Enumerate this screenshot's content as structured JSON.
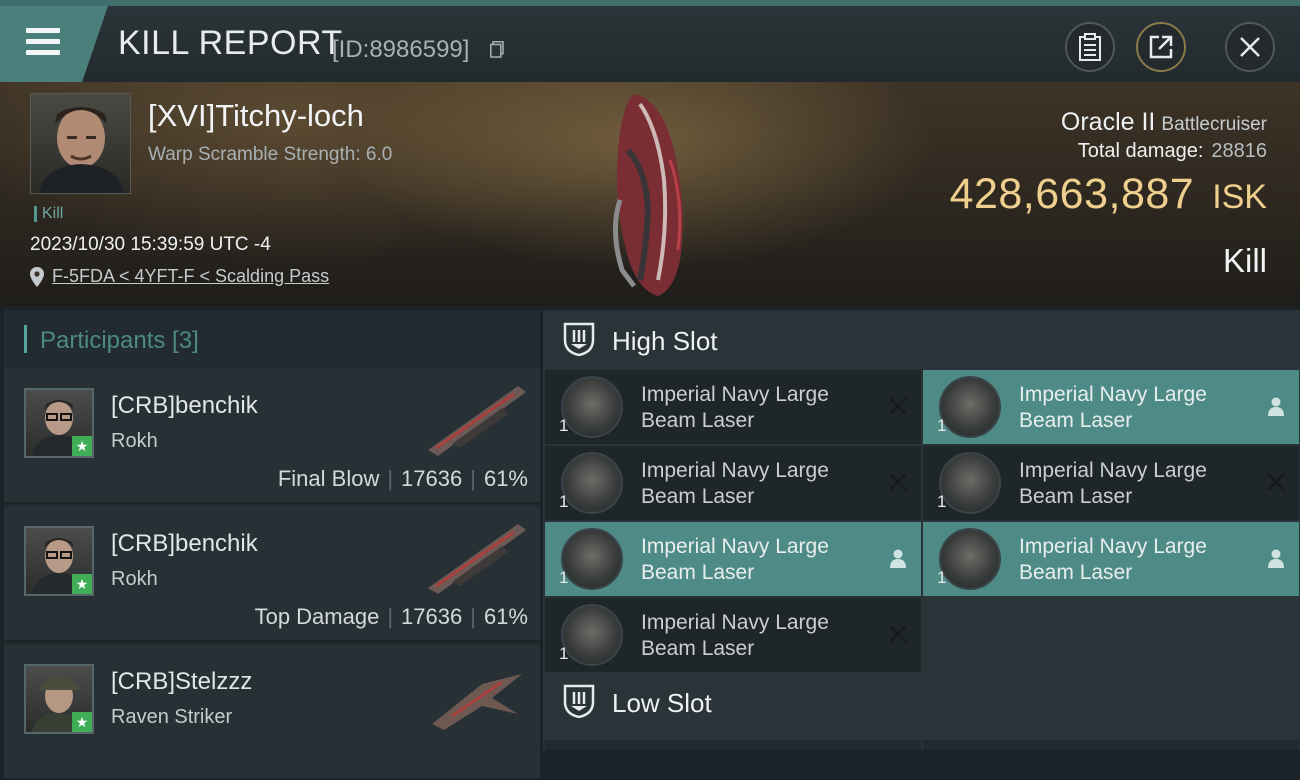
{
  "header": {
    "title": "KILL REPORT",
    "report_id": "[ID:8986599]"
  },
  "victim": {
    "name": "[XVI]Titchy-loch",
    "warp_scramble": "Warp Scramble Strength: 6.0",
    "tag": "Kill",
    "datetime": "2023/10/30 15:39:59 UTC -4",
    "location": "F-5FDA < 4YFT-F < Scalding Pass",
    "ship_name": "Oracle II",
    "ship_class": "Battlecruiser",
    "total_damage_label": "Total damage:",
    "total_damage_value": "28816",
    "isk_value": "428,663,887",
    "isk_unit": "ISK",
    "result": "Kill"
  },
  "participants": {
    "title": "Participants [3]",
    "rows": [
      {
        "name": "[CRB]benchik",
        "ship": "Rokh",
        "role": "Final Blow",
        "damage": "17636",
        "percent": "61%"
      },
      {
        "name": "[CRB]benchik",
        "ship": "Rokh",
        "role": "Top Damage",
        "damage": "17636",
        "percent": "61%"
      },
      {
        "name": "[CRB]Stelzzz",
        "ship": "Raven Striker",
        "role": "",
        "damage": "",
        "percent": ""
      }
    ]
  },
  "slots": {
    "high_title": "High Slot",
    "low_title": "Low Slot",
    "modules": [
      {
        "name": "Imperial Navy Large Beam Laser",
        "qty": "1",
        "state": "destroyed",
        "style": "dark"
      },
      {
        "name": "Imperial Navy Large Beam Laser",
        "qty": "1",
        "state": "dropped",
        "style": "active"
      },
      {
        "name": "Imperial Navy Large Beam Laser",
        "qty": "1",
        "state": "destroyed",
        "style": "dark"
      },
      {
        "name": "Imperial Navy Large Beam Laser",
        "qty": "1",
        "state": "destroyed",
        "style": "dark"
      },
      {
        "name": "Imperial Navy Large Beam Laser",
        "qty": "1",
        "state": "dropped",
        "style": "active"
      },
      {
        "name": "Imperial Navy Large Beam Laser",
        "qty": "1",
        "state": "dropped",
        "style": "active"
      },
      {
        "name": "Imperial Navy Large Beam Laser",
        "qty": "1",
        "state": "destroyed",
        "style": "dark"
      }
    ]
  },
  "colors": {
    "accent_teal": "#4f8b86",
    "isk_gold": "#efcf8e",
    "star_green": "#3fae57"
  }
}
